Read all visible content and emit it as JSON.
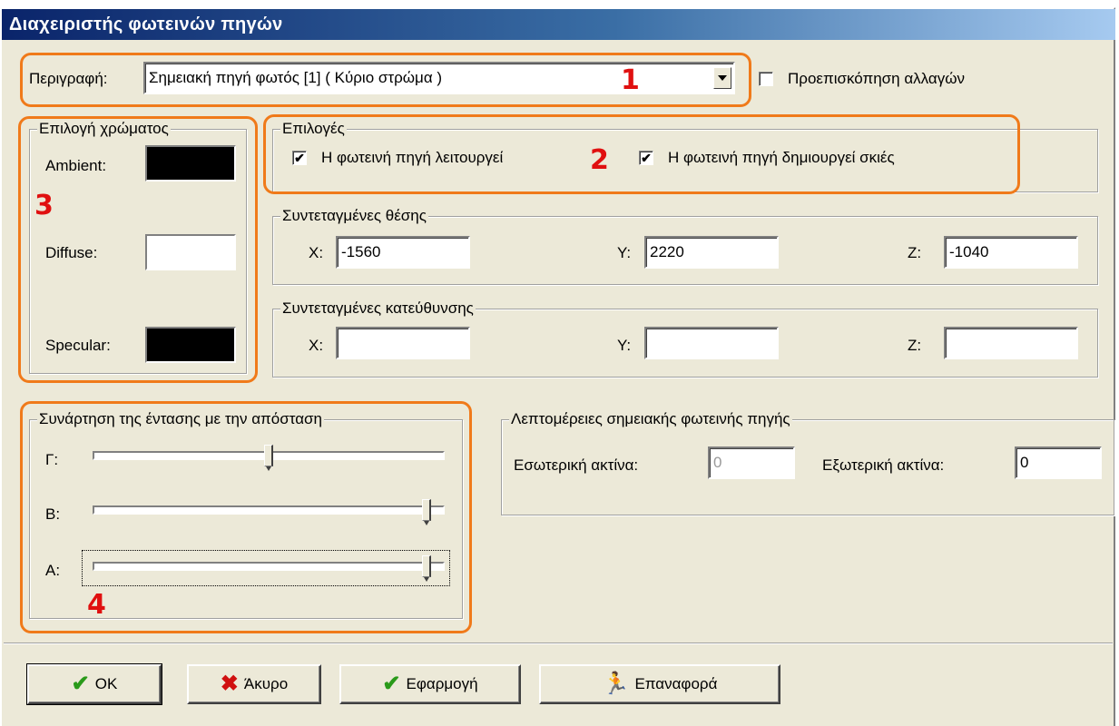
{
  "window": {
    "title": "Διαχειριστής φωτεινών πηγών"
  },
  "description": {
    "label": "Περιγραφή:",
    "value": "Σημειακή πηγή φωτός [1] ( Κύριο στρώμα )",
    "preview_label": "Προεπισκόπηση αλλαγών",
    "preview_checked": false
  },
  "color_group": {
    "title": "Επιλογή χρώματος",
    "ambient_label": "Ambient:",
    "ambient_color": "#000000",
    "diffuse_label": "Diffuse:",
    "diffuse_color": "#ffffff",
    "specular_label": "Specular:",
    "specular_color": "#000000"
  },
  "options_group": {
    "title": "Επιλογές",
    "light_works_label": "Η φωτεινή πηγή λειτουργεί",
    "light_works_checked": true,
    "shadows_label": "Η φωτεινή πηγή δημιουργεί σκιές",
    "shadows_checked": true
  },
  "position_group": {
    "title": "Συντεταγμένες θέσης",
    "x_label": "X:",
    "x_value": "-1560",
    "y_label": "Y:",
    "y_value": "2220",
    "z_label": "Z:",
    "z_value": "-1040"
  },
  "direction_group": {
    "title": "Συντεταγμένες κατεύθυνσης",
    "x_label": "X:",
    "x_value": "",
    "y_label": "Y:",
    "y_value": "",
    "z_label": "Z:",
    "z_value": ""
  },
  "attenuation_group": {
    "title": "Συνάρτηση της έντασης με την απόσταση",
    "g_label": "Γ:",
    "g_level": 0.5,
    "b_label": "B:",
    "b_level": 0.96,
    "a_label": "A:",
    "a_level": 0.96
  },
  "details_group": {
    "title": "Λεπτομέρειες σημειακής φωτεινής πηγής",
    "inner_label": "Εσωτερική ακτίνα:",
    "inner_value": "0",
    "outer_label": "Εξωτερική ακτίνα:",
    "outer_value": "0"
  },
  "buttons": {
    "ok": "OK",
    "cancel": "Άκυρο",
    "apply": "Εφαρμογή",
    "reset": "Επαναφορά"
  },
  "annotations": {
    "n1": "1",
    "n2": "2",
    "n3": "3",
    "n4": "4",
    "color": "#f07a1a"
  }
}
